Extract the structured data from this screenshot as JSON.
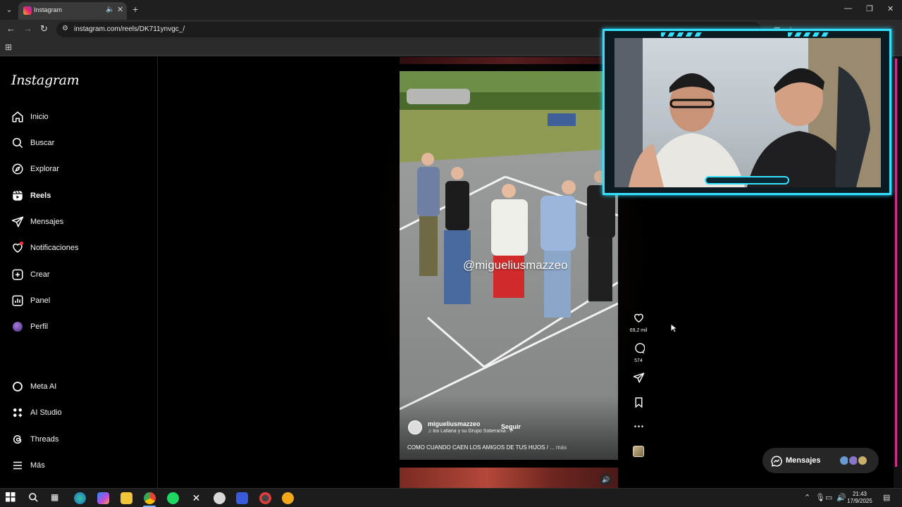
{
  "browser": {
    "tab_title": "Instagram",
    "url": "instagram.com/reels/DK711ynvgc_/"
  },
  "sidebar": {
    "logo": "Instagram",
    "items": [
      {
        "label": "Inicio",
        "icon": "home-icon"
      },
      {
        "label": "Buscar",
        "icon": "search-icon"
      },
      {
        "label": "Explorar",
        "icon": "compass-icon"
      },
      {
        "label": "Reels",
        "icon": "reels-icon",
        "active": true
      },
      {
        "label": "Mensajes",
        "icon": "send-icon"
      },
      {
        "label": "Notificaciones",
        "icon": "heart-icon"
      },
      {
        "label": "Crear",
        "icon": "plus-square-icon"
      },
      {
        "label": "Panel",
        "icon": "chart-icon"
      },
      {
        "label": "Perfil",
        "icon": "avatar"
      }
    ],
    "bottom_items": [
      {
        "label": "Meta AI",
        "icon": "meta-ai-icon"
      },
      {
        "label": "AI Studio",
        "icon": "ai-studio-icon"
      },
      {
        "label": "Threads",
        "icon": "threads-icon"
      },
      {
        "label": "Más",
        "icon": "menu-icon"
      }
    ]
  },
  "reel": {
    "watermark": "@migueliusmazzeo",
    "author": "migueliusmazzeo",
    "follow_label": "Seguir",
    "audio": "los Lallana y su Grupo Soberania · P",
    "caption": "COMO CUANDO CAEN LOS AMIGOS DE TUS HIJOS /",
    "more_label": "... más",
    "likes": "69,2 mil",
    "comments": "574"
  },
  "messages_pill": {
    "label": "Mensajes"
  },
  "taskbar": {
    "time": "21:43",
    "date": "17/9/2025"
  },
  "colors": {
    "accent_cam": "#33e1ff",
    "notification": "#ff3040",
    "scrollbar": "#d62a8a"
  }
}
